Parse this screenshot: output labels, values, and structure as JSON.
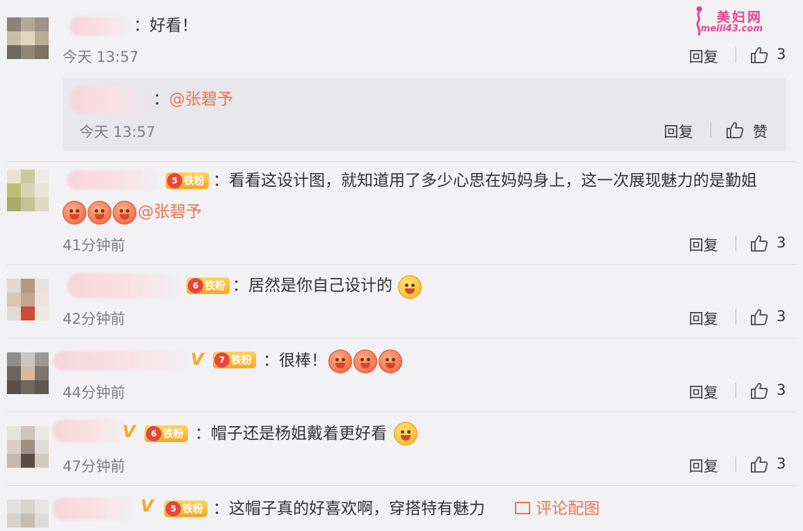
{
  "watermark": {
    "cn": "美妇网",
    "en": "meili43.com"
  },
  "comments": [
    {
      "text": "：好看！",
      "time": "今天 13:57",
      "reply": "回复",
      "likes": "3"
    },
    {
      "text": "：看看这设计图，就知道用了多少心思在妈妈身上，这一次展现魅力的是勤姐",
      "mention": "@张碧予",
      "time": "41分钟前",
      "reply": "回复",
      "likes": "3",
      "badge": "铁粉",
      "level": "5"
    },
    {
      "text": "：居然是你自己设计的",
      "time": "42分钟前",
      "reply": "回复",
      "likes": "3",
      "badge": "铁粉",
      "level": "6"
    },
    {
      "text": "：很棒！",
      "time": "44分钟前",
      "reply": "回复",
      "likes": "3",
      "badge": "铁粉",
      "level": "7"
    },
    {
      "text": "：帽子还是杨姐戴着更好看",
      "time": "47分钟前",
      "reply": "回复",
      "likes": "3",
      "badge": "铁粉",
      "level": "6"
    },
    {
      "text": "：这帽子真的好喜欢啊，穿搭特有魅力",
      "badge": "铁粉",
      "level": "5",
      "pic_link": "评论配图"
    }
  ],
  "sub_reply": {
    "prefix": "：",
    "mention": "@张碧予",
    "time": "今天 13:57",
    "reply": "回复",
    "like_label": "赞"
  }
}
